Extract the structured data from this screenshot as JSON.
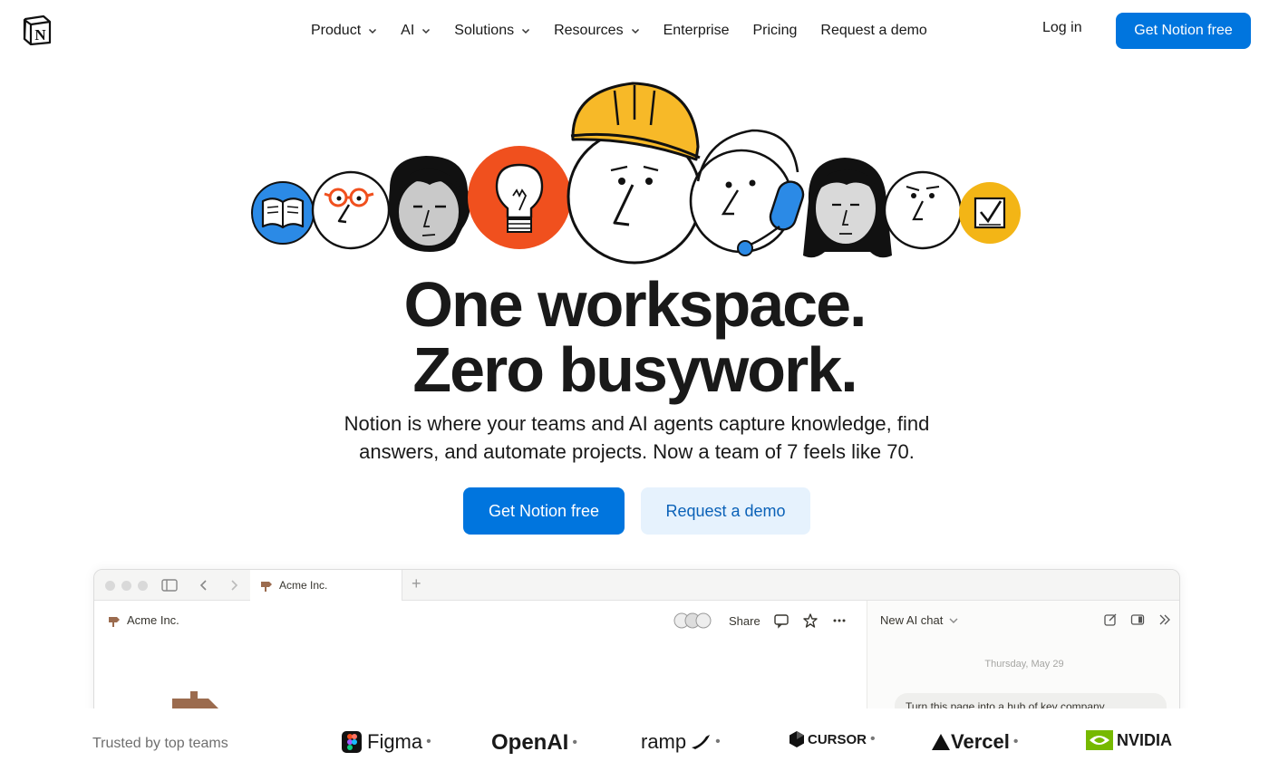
{
  "nav": {
    "logo_letter": "N",
    "items": [
      {
        "label": "Product",
        "dropdown": true
      },
      {
        "label": "AI",
        "dropdown": true
      },
      {
        "label": "Solutions",
        "dropdown": true
      },
      {
        "label": "Resources",
        "dropdown": true
      },
      {
        "label": "Enterprise",
        "dropdown": false
      },
      {
        "label": "Pricing",
        "dropdown": false
      },
      {
        "label": "Request a demo",
        "dropdown": false
      }
    ],
    "login": "Log in",
    "cta": "Get Notion free"
  },
  "hero": {
    "headline_1": "One workspace.",
    "headline_2": "Zero busywork.",
    "subline_1": "Notion is where your teams and AI agents capture knowledge, find",
    "subline_2": "answers, and automate projects. Now a team of 7 feels like 70.",
    "primary_cta": "Get Notion free",
    "secondary_cta": "Request a demo"
  },
  "app_preview": {
    "tab_label": "Acme Inc.",
    "page_title": "Acme Inc.",
    "share_label": "Share",
    "ai_chat_title": "New AI chat",
    "ai_date": "Thursday, May 29",
    "ai_message": "Turn this page into a hub of key company"
  },
  "trust": {
    "label": "Trusted by top teams",
    "brands": [
      "Figma",
      "OpenAI",
      "ramp",
      "CURSOR",
      "Vercel",
      "NVIDIA"
    ]
  },
  "colors": {
    "accent": "#0075de",
    "accent_soft": "#e6f2fd",
    "blue_circle": "#2b8ae6",
    "orange_circle": "#f0501e",
    "yellow_helmet": "#f7b928",
    "yellow_circle": "#f3b516"
  }
}
